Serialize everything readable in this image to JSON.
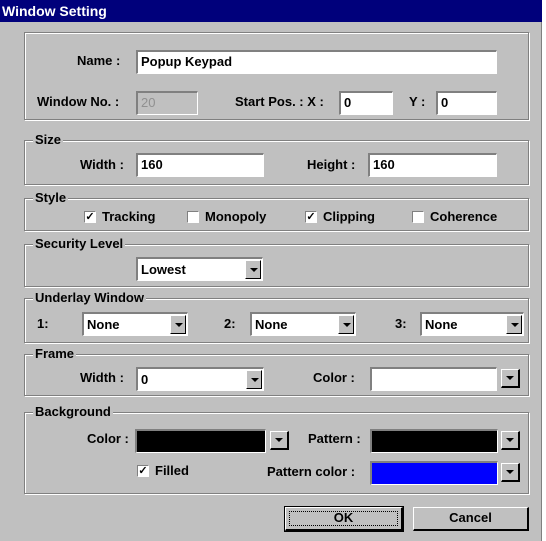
{
  "titlebar": {
    "title": "Window Setting"
  },
  "general": {
    "name_label": "Name :",
    "name_value": "Popup Keypad",
    "window_no_label": "Window No. :",
    "window_no_value": "20",
    "start_pos_label": "Start Pos. : X :",
    "x_value": "0",
    "y_label": "Y :",
    "y_value": "0"
  },
  "size": {
    "legend": "Size",
    "width_label": "Width :",
    "width_value": "160",
    "height_label": "Height :",
    "height_value": "160"
  },
  "style": {
    "legend": "Style",
    "options": [
      {
        "label": "Tracking",
        "checked": true
      },
      {
        "label": "Monopoly",
        "checked": false
      },
      {
        "label": "Clipping",
        "checked": true
      },
      {
        "label": "Coherence",
        "checked": false
      }
    ]
  },
  "security": {
    "legend": "Security  Level",
    "value": "Lowest"
  },
  "underlay": {
    "legend": "Underlay Window",
    "items": [
      {
        "label": "1:",
        "value": "None"
      },
      {
        "label": "2:",
        "value": "None"
      },
      {
        "label": "3:",
        "value": "None"
      }
    ]
  },
  "frame": {
    "legend": "Frame",
    "width_label": "Width :",
    "width_value": "0",
    "color_label": "Color :",
    "color_value": "#ffffff"
  },
  "background": {
    "legend": "Background",
    "color_label": "Color :",
    "color_value": "#000000",
    "pattern_label": "Pattern :",
    "pattern_value": "#000000",
    "filled_label": "Filled",
    "filled_checked": true,
    "pattern_color_label": "Pattern color :",
    "pattern_color_value": "#0000ff"
  },
  "buttons": {
    "ok": "OK",
    "cancel": "Cancel"
  },
  "icons": {
    "check": "✓",
    "dropdown": "chevron-down-icon"
  }
}
